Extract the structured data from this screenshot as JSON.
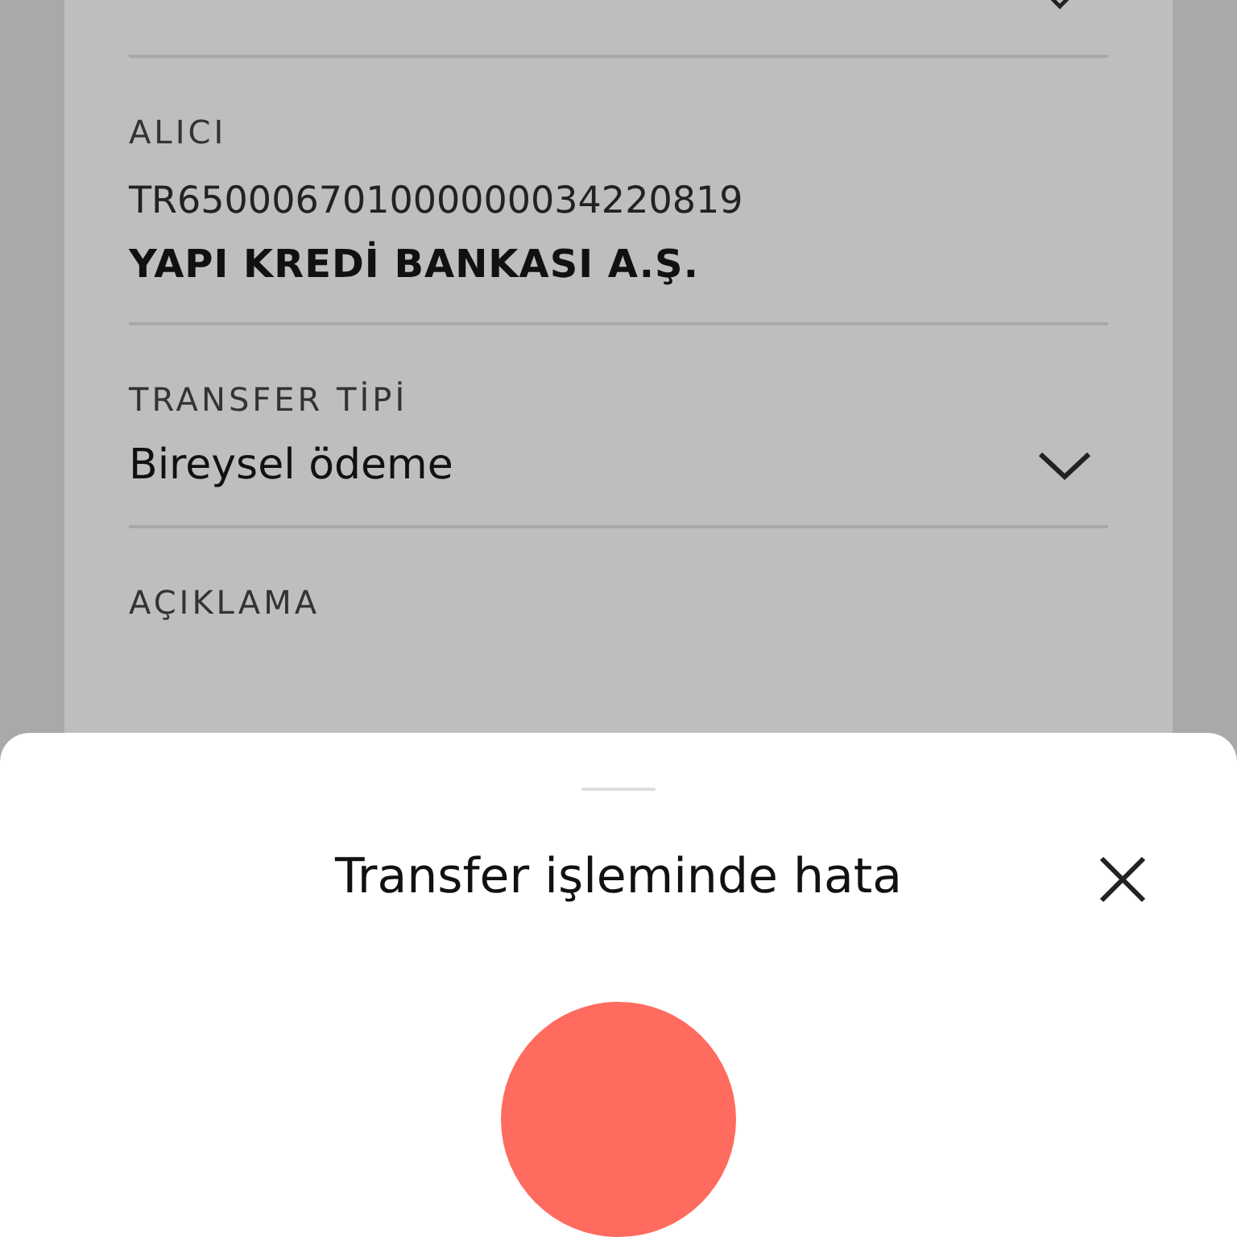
{
  "form": {
    "sections": [
      {
        "label": "ALICI",
        "lines": [
          {
            "text": "TR650006701000000034220819",
            "kind": "plain"
          },
          {
            "text": "YAPI KREDİ BANKASI A.Ş.",
            "kind": "strong"
          }
        ]
      },
      {
        "label": "TRANSFER TİPİ",
        "lines": [
          {
            "text": "Bireysel ödeme",
            "kind": "select"
          }
        ]
      },
      {
        "label": "AÇIKLAMA"
      }
    ]
  },
  "sheet": {
    "title": "Transfer işleminde hata"
  }
}
